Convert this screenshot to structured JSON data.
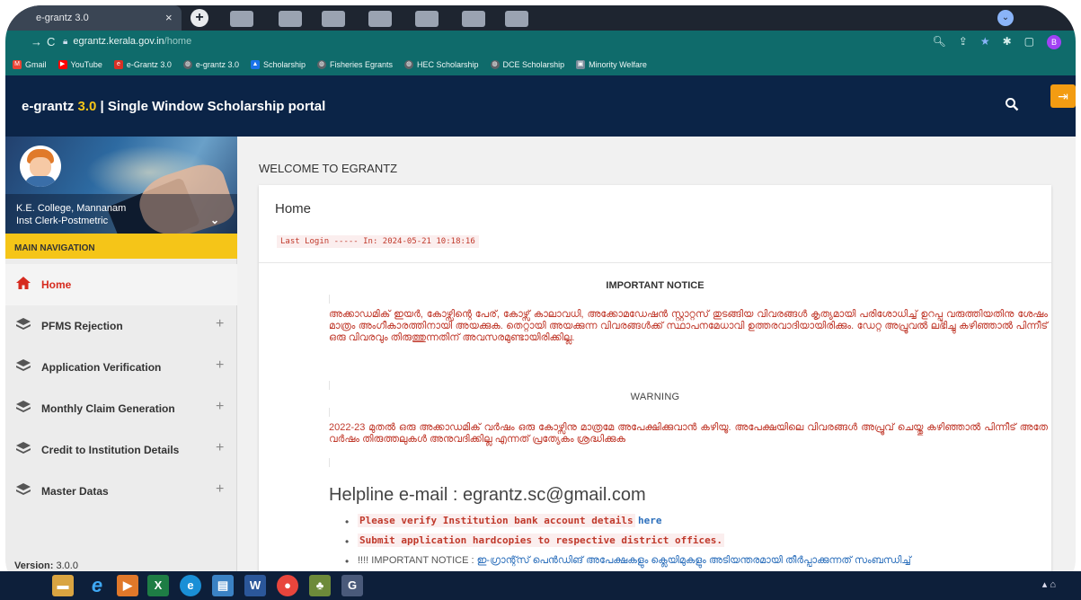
{
  "browser": {
    "tab_title": "e-grantz 3.0",
    "tab_close": "×",
    "new_tab": "+",
    "url_host": "egrantz.kerala.gov.in",
    "url_path": "/home",
    "profile_initial": "B",
    "bookmarks": [
      {
        "label": "Gmail",
        "icon": "gmail-icon",
        "color": "#ea4335"
      },
      {
        "label": "YouTube",
        "icon": "youtube-icon",
        "color": "#ff0000"
      },
      {
        "label": "e-Grantz 3.0",
        "icon": "egrantz-icon",
        "color": "#d93025"
      },
      {
        "label": "e-grantz 3.0",
        "icon": "globe-icon",
        "color": "#5f6368"
      },
      {
        "label": "Scholarship",
        "icon": "scholarship-icon",
        "color": "#1a73e8"
      },
      {
        "label": "Fisheries Egrants",
        "icon": "globe-icon",
        "color": "#5f6368"
      },
      {
        "label": "HEC Scholarship",
        "icon": "globe-icon",
        "color": "#5f6368"
      },
      {
        "label": "DCE Scholarship",
        "icon": "globe-icon",
        "color": "#5f6368"
      },
      {
        "label": "Minority Welfare",
        "icon": "minority-icon",
        "color": "#7b8b9a"
      }
    ]
  },
  "header": {
    "brand": "e-grantz",
    "version": "3.0",
    "rest": "| Single Window Scholarship portal"
  },
  "sidebar": {
    "user_name": "K.E. College, Mannanam",
    "user_role": "Inst Clerk-Postmetric",
    "main_nav": "MAIN NAVIGATION",
    "items": [
      {
        "label": "Home",
        "active": true
      },
      {
        "label": "PFMS Rejection"
      },
      {
        "label": "Application Verification"
      },
      {
        "label": "Monthly Claim Generation"
      },
      {
        "label": "Credit to Institution Details"
      },
      {
        "label": "Master Datas"
      }
    ],
    "expand_symbol": "+",
    "version_label": "Version:",
    "version_value": "3.0.0"
  },
  "main": {
    "welcome": "WELCOME TO EGRANTZ",
    "card_title": "Home",
    "last_login": "Last Login ----- In: 2024-05-21 10:18:16",
    "notice_heading": "IMPORTANT NOTICE",
    "notice_text": "അക്കാഡമിക് ഇയർ, കോഴ്സിന്റെ പേര്, കോഴ്സ് കാലാവധി, അക്കോമഡേഷൻ സ്റ്റാറ്റസ് തുടങ്ങിയ വിവരങ്ങൾ കൃത്യമായി പരിശോധിച്ച് ഉറപ്പു വരുത്തിയതിനു ശേഷം മാത്രം അംഗീകാരത്തിനായി അയക്കുക. തെറ്റായി അയക്കുന്ന വിവരങ്ങൾക്ക് സ്ഥാപനമേധാവി ഉത്തരവാദിയായിരിക്കും. ഡേറ്റ അപ്രൂവൽ ലഭിച്ചു കഴിഞ്ഞാൽ പിന്നീട് ഒരു വിവരവും തിരുത്തുന്നതിന് അവസരമുണ്ടായിരിക്കില്ല.",
    "warning_heading": "WARNING",
    "warning_text": "2022-23 മുതൽ ഒരു അക്കാഡമിക് വർഷം ഒരു കോഴ്സിനു മാത്രമേ അപേക്ഷിക്കുവാൻ കഴിയൂ. അപേക്ഷയിലെ വിവരങ്ങൾ അപ്രൂവ് ചെയ്തു കഴിഞ്ഞാൽ പിന്നീട് അതേ വർഷം തിരുത്തലുകൾ അനുവദിക്കില്ല എന്നത് പ്രത്യേകം ശ്രദ്ധിക്കുക",
    "helpline": "Helpline e-mail : egrantz.sc@gmail.com",
    "bullet1": "Please verify Institution bank account details",
    "bullet1_link": "here",
    "bullet2": "Submit application hardcopies to respective district offices.",
    "bullet3_prefix": "!!!! IMPORTANT NOTICE :",
    "bullet3_text": "ഇ-ഗ്രാന്റ്സ് പെൻഡിങ് അപേക്ഷകളും ക്ലെയിമുകളും അടിയന്തരമായി തീർപ്പാക്കുന്നത് സംബന്ധിച്ച്"
  },
  "colors": {
    "header_bg": "#0b2447",
    "accent": "#f5c518",
    "active_nav": "#d62b1f",
    "notice_text": "#c0392b"
  }
}
